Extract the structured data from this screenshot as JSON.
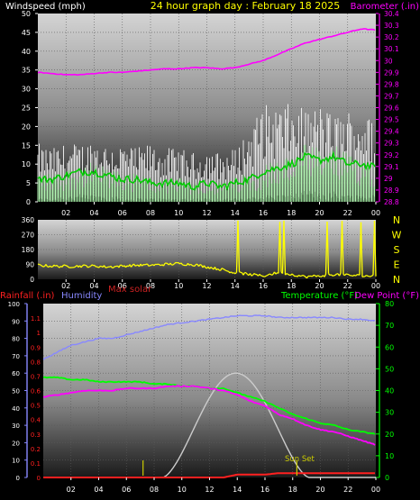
{
  "title": "24 hour graph day : February 18 2025",
  "colors": {
    "background": "#000000",
    "title": "#ffff00",
    "wind": "#ffffff",
    "barometer": "#ff00ff",
    "gust_fill": "#ffffff",
    "wind_avg": "#00cc00",
    "wind_fill": "#aaffaa",
    "direction": "#ffff00",
    "rain": "#ff2020",
    "humidity": "#8888ff",
    "solar": "#cccccc",
    "max_solar_label": "#cc2222",
    "temperature": "#00ff00",
    "dewpoint": "#ff00ff",
    "tick": "#ffffff",
    "sun_marker": "#cccc00"
  },
  "chart_data": [
    {
      "type": "line",
      "id": "wind-baro",
      "left_label": "Windspeed (mph)",
      "right_label": "Barometer (.in)",
      "xlabels": [
        "02",
        "04",
        "06",
        "08",
        "10",
        "12",
        "14",
        "16",
        "18",
        "20",
        "22",
        "00"
      ],
      "ylim_left": [
        0,
        50
      ],
      "yticks_left": [
        "0",
        "5",
        "10",
        "15",
        "20",
        "25",
        "30",
        "35",
        "40",
        "45",
        "50"
      ],
      "ylim_right": [
        28.8,
        30.4
      ],
      "yticks_right": [
        "28.8",
        "28.9",
        "29",
        "29.1",
        "29.2",
        "29.3",
        "29.4",
        "29.5",
        "29.6",
        "29.7",
        "29.8",
        "29.9",
        "30",
        "30.1",
        "30.2",
        "30.3",
        "30.4"
      ],
      "x_hours": [
        0,
        1,
        2,
        3,
        4,
        5,
        6,
        7,
        8,
        9,
        10,
        11,
        12,
        13,
        14,
        15,
        16,
        17,
        18,
        19,
        20,
        21,
        22,
        23,
        24
      ],
      "series": [
        {
          "key": "barometer",
          "axis": "right",
          "values": [
            29.9,
            29.89,
            29.88,
            29.88,
            29.89,
            29.9,
            29.9,
            29.91,
            29.92,
            29.93,
            29.93,
            29.94,
            29.94,
            29.93,
            29.94,
            29.97,
            30.0,
            30.05,
            30.1,
            30.15,
            30.18,
            30.21,
            30.24,
            30.27,
            30.26
          ]
        },
        {
          "key": "gust",
          "axis": "left",
          "values": [
            12,
            11,
            12,
            12,
            13,
            12,
            12,
            11,
            12,
            11,
            11,
            10,
            11,
            10,
            11,
            15,
            20,
            20,
            20,
            19,
            20,
            18,
            19,
            19,
            16
          ]
        },
        {
          "key": "wind_avg",
          "axis": "left",
          "values": [
            6,
            6,
            7,
            8,
            8,
            7,
            6,
            6,
            5,
            5,
            5,
            4,
            5,
            4,
            5,
            6,
            8,
            9,
            10,
            12,
            11,
            12,
            10,
            10,
            9
          ]
        },
        {
          "key": "wind_low",
          "axis": "left",
          "values": [
            1,
            1,
            2,
            2,
            2,
            2,
            1,
            1,
            1,
            1,
            1,
            1,
            1,
            1,
            1,
            1,
            2,
            2,
            2,
            3,
            3,
            3,
            2,
            2,
            2
          ]
        }
      ]
    },
    {
      "type": "scatter",
      "id": "wind-direction",
      "xlabels": [
        "02",
        "04",
        "06",
        "08",
        "10",
        "12",
        "14",
        "16",
        "18",
        "20",
        "22",
        "00"
      ],
      "ylim": [
        0,
        360
      ],
      "yticks": [
        "0",
        "90",
        "180",
        "270",
        "360"
      ],
      "compass": [
        "N",
        "W",
        "S",
        "E",
        "N"
      ],
      "x_hours": [
        0,
        1,
        2,
        3,
        4,
        5,
        6,
        7,
        8,
        9,
        10,
        11,
        12,
        13,
        14,
        15,
        16,
        17,
        18,
        19,
        20,
        21,
        22,
        23,
        24
      ],
      "values": [
        85,
        80,
        78,
        80,
        80,
        75,
        80,
        85,
        85,
        90,
        95,
        90,
        75,
        60,
        40,
        30,
        20,
        40,
        30,
        15,
        20,
        30,
        25,
        20,
        20
      ]
    },
    {
      "type": "line",
      "id": "temp-hum-rain",
      "labels": {
        "rain": "Rainfall (.in)",
        "humidity": "Humidity",
        "max_solar": "Max solar",
        "temperature": "Temperature (°F)",
        "dewpoint": "Dew Point (°F)",
        "sunset": "Sun Set"
      },
      "xlabels": [
        "02",
        "04",
        "06",
        "08",
        "10",
        "12",
        "14",
        "16",
        "18",
        "20",
        "22",
        "00"
      ],
      "ylim_humidity": [
        0,
        100
      ],
      "yticks_humidity": [
        "0",
        "10",
        "20",
        "30",
        "40",
        "50",
        "60",
        "70",
        "80",
        "90",
        "100"
      ],
      "ylim_rain": [
        0,
        1.2
      ],
      "yticks_rain": [
        "0",
        "0.1",
        "0.2",
        "0.3",
        "0.4",
        "0.5",
        "0.6",
        "0.7",
        "0.8",
        "0.9",
        "1",
        "1.1"
      ],
      "ylim_temp": [
        0,
        80
      ],
      "yticks_temp": [
        "0",
        "10",
        "20",
        "30",
        "40",
        "50",
        "60",
        "70",
        "80"
      ],
      "x_hours": [
        0,
        1,
        2,
        3,
        4,
        5,
        6,
        7,
        8,
        9,
        10,
        11,
        12,
        13,
        14,
        15,
        16,
        17,
        18,
        19,
        20,
        21,
        22,
        23,
        24
      ],
      "series": [
        {
          "key": "humidity",
          "axis": "humidity",
          "values": [
            68,
            72,
            76,
            78,
            80,
            80,
            82,
            84,
            86,
            88,
            89,
            90,
            91,
            92,
            93,
            93,
            93,
            92,
            92,
            92,
            92,
            92,
            91,
            91,
            90
          ]
        },
        {
          "key": "temperature",
          "axis": "temp",
          "values": [
            46,
            46,
            45,
            45,
            44,
            44,
            44,
            44,
            43,
            43,
            42,
            42,
            41,
            41,
            39,
            37,
            35,
            32,
            29,
            27,
            25,
            24,
            22,
            21,
            20
          ]
        },
        {
          "key": "dewpoint",
          "axis": "temp",
          "values": [
            37,
            38,
            39,
            40,
            40,
            40,
            41,
            41,
            41,
            42,
            42,
            42,
            41,
            40,
            38,
            35,
            33,
            29,
            27,
            24,
            22,
            21,
            19,
            17,
            15
          ]
        },
        {
          "key": "rain",
          "axis": "rain",
          "values": [
            0,
            0,
            0,
            0,
            0,
            0,
            0,
            0,
            0,
            0,
            0,
            0,
            0,
            0,
            0.02,
            0.02,
            0.02,
            0.03,
            0.03,
            0.03,
            0.03,
            0.03,
            0.03,
            0.03,
            0.03
          ]
        },
        {
          "key": "max_solar",
          "axis": "humidity",
          "values": [
            0,
            0,
            0,
            0,
            0,
            0,
            0,
            0,
            0,
            1,
            12,
            30,
            46,
            56,
            60,
            56,
            40,
            22,
            3,
            0,
            0,
            0,
            0,
            0,
            0
          ]
        }
      ],
      "markers": [
        {
          "key": "sunrise",
          "hour": 7.2
        },
        {
          "key": "sunset",
          "hour": 18.3
        }
      ]
    }
  ]
}
